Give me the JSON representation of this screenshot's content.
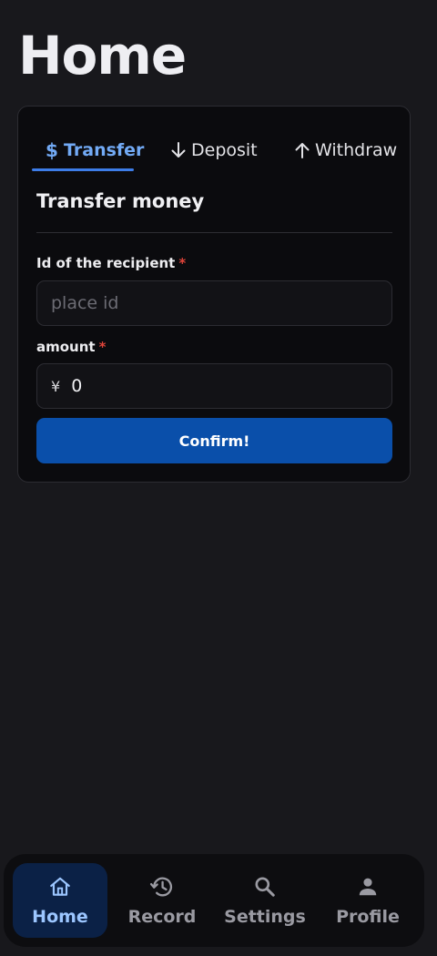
{
  "page": {
    "title": "Home"
  },
  "tabs": [
    {
      "label": "Transfer",
      "icon": "dollar-icon",
      "active": true
    },
    {
      "label": "Deposit",
      "icon": "arrow-down-icon",
      "active": false
    },
    {
      "label": "Withdraw",
      "icon": "arrow-up-icon",
      "active": false
    }
  ],
  "form": {
    "title": "Transfer money",
    "recipient": {
      "label": "Id of the recipient",
      "required_mark": "*",
      "placeholder": "place id",
      "value": ""
    },
    "amount": {
      "label": "amount",
      "required_mark": "*",
      "currency": "¥",
      "value": "0"
    },
    "confirm_label": "Confirm!"
  },
  "nav": [
    {
      "label": "Home",
      "icon": "home-icon",
      "active": true
    },
    {
      "label": "Record",
      "icon": "history-icon",
      "active": false
    },
    {
      "label": "Settings",
      "icon": "search-icon",
      "active": false
    },
    {
      "label": "Profile",
      "icon": "person-icon",
      "active": false
    }
  ],
  "colors": {
    "background": "#18181c",
    "card": "#0b0b0e",
    "accent": "#3d7de8",
    "button": "#0a4faa",
    "required": "#e0443a",
    "nav_active_bg": "#0b2146"
  }
}
